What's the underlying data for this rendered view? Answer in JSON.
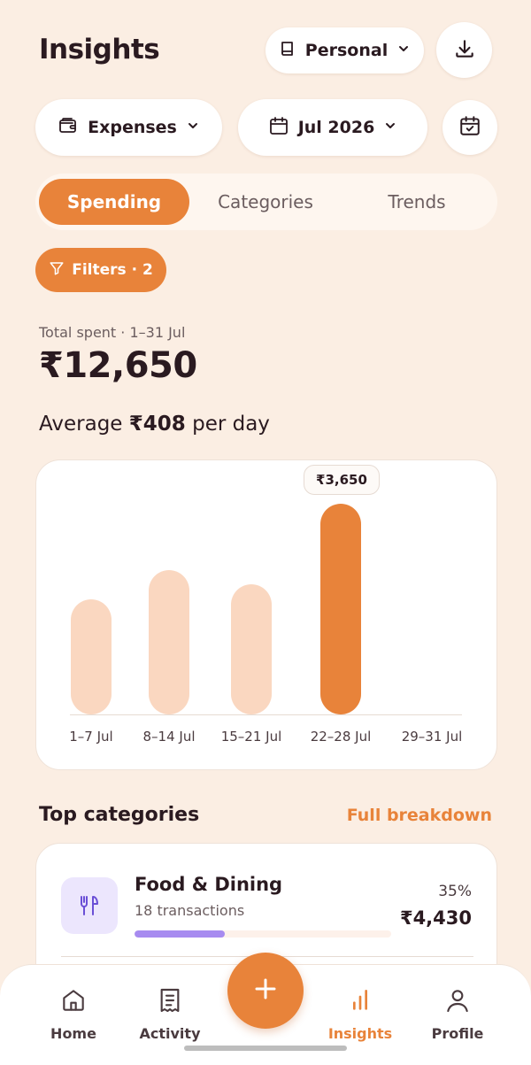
{
  "header": {
    "title": "Insights",
    "account_label": "Personal"
  },
  "controls": {
    "type_label": "Expenses",
    "month_label": "Jul 2026"
  },
  "tabs": [
    {
      "label": "Spending",
      "active": true
    },
    {
      "label": "Categories",
      "active": false
    },
    {
      "label": "Trends",
      "active": false
    }
  ],
  "filters": {
    "label": "Filters · 2"
  },
  "summary": {
    "total_label": "Total spent · 1–31 Jul",
    "total_value": "₹12,650",
    "avg_prefix": "Average",
    "avg_value": "₹408",
    "avg_suffix": "per day"
  },
  "chart_data": {
    "type": "bar",
    "categories": [
      "1–7 Jul",
      "8–14 Jul",
      "15–21 Jul",
      "22–28 Jul",
      "29–31 Jul"
    ],
    "values": [
      2000,
      2500,
      2250,
      3650,
      0
    ],
    "highlight_index": 3,
    "highlight_label": "₹3,650",
    "ylim": [
      0,
      3650
    ],
    "grid": false,
    "colors": {
      "bar": "#fad7c0",
      "highlight": "#e8833a"
    }
  },
  "top_categories": {
    "title": "Top categories",
    "link_label": "Full breakdown",
    "items": [
      {
        "name": "Food & Dining",
        "sub": "18 transactions",
        "pct": "35%",
        "amount": "₹4,430",
        "progress": 0.35,
        "icon": "utensils-icon"
      }
    ]
  },
  "nav": {
    "items": [
      {
        "label": "Home",
        "icon": "home-icon",
        "active": false
      },
      {
        "label": "Activity",
        "icon": "receipt-icon",
        "active": false
      },
      {
        "label": "Insights",
        "icon": "bar-chart-icon",
        "active": true
      },
      {
        "label": "Profile",
        "icon": "user-icon",
        "active": false
      }
    ]
  },
  "colors": {
    "accent": "#e8833a",
    "background": "#fbeee3",
    "lavender": "#a78bf0"
  }
}
